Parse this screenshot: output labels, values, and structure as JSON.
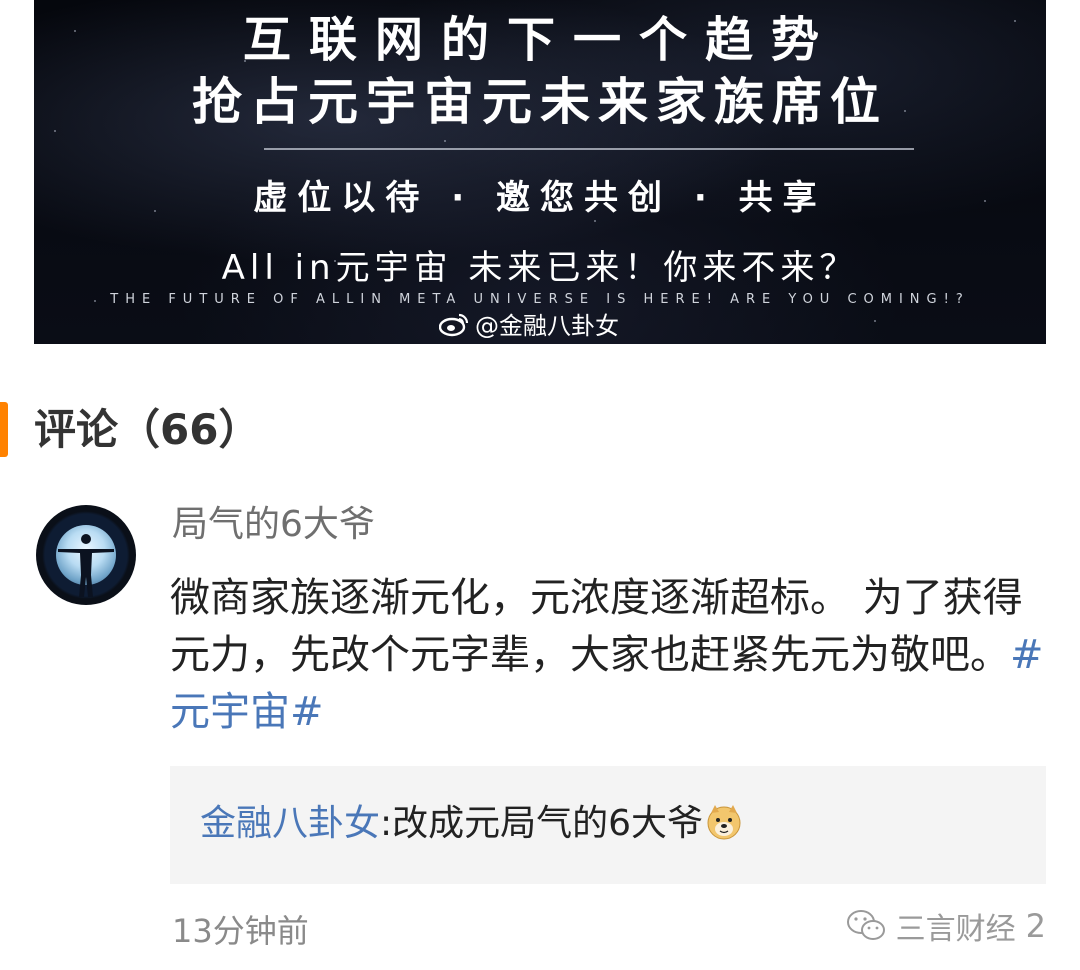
{
  "banner": {
    "title_line1": "互联网的下一个趋势",
    "title_line2": "抢占元宇宙元未来家族席位",
    "subtitle": "虚位以待 · 邀您共创 · 共享",
    "tagline": "All in元宇宙 未来已来！你来不来？",
    "english": "THE FUTURE OF ALLIN META UNIVERSE IS HERE! ARE YOU COMING!?",
    "watermark": "@金融八卦女"
  },
  "comments": {
    "header": "评论（66）",
    "accent_color": "#ff8200",
    "items": [
      {
        "username": "局气的6大爷",
        "text": "微商家族逐渐元化，元浓度逐渐超标。 为了获得元力，先改个元字辈，大家也赶紧先元为敬吧。",
        "hashtag": "#元宇宙#",
        "reply": {
          "name": "金融八卦女",
          "text": ":改成元局气的6大爷",
          "emoji": "doge-emoji"
        },
        "time": "13分钟前"
      }
    ]
  },
  "corner": {
    "label": "三言财经",
    "count": "2",
    "icon": "wechat-icon"
  }
}
